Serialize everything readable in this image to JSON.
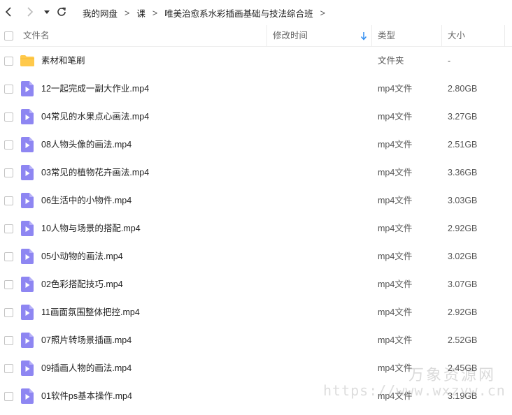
{
  "breadcrumb": [
    "我的网盘",
    "课",
    "唯美治愈系水彩插画基础与技法综合班"
  ],
  "breadcrumb_separator": ">",
  "columns": {
    "name": "文件名",
    "modified": "修改时间",
    "type": "类型",
    "size": "大小"
  },
  "sort": {
    "column": "modified",
    "direction": "descending"
  },
  "colors": {
    "folder": "#FFC94B",
    "video": "#8E86F2",
    "sort_arrow": "#2F8CF0"
  },
  "files": [
    {
      "name": "素材和笔刷",
      "type": "文件夹",
      "size": "-",
      "icon": "folder-icon"
    },
    {
      "name": "12一起完成一副大作业.mp4",
      "type": "mp4文件",
      "size": "2.80GB",
      "icon": "video-file-icon"
    },
    {
      "name": "04常见的水果点心画法.mp4",
      "type": "mp4文件",
      "size": "3.27GB",
      "icon": "video-file-icon"
    },
    {
      "name": "08人物头像的画法.mp4",
      "type": "mp4文件",
      "size": "2.51GB",
      "icon": "video-file-icon"
    },
    {
      "name": "03常见的植物花卉画法.mp4",
      "type": "mp4文件",
      "size": "3.36GB",
      "icon": "video-file-icon"
    },
    {
      "name": "06生活中的小物件.mp4",
      "type": "mp4文件",
      "size": "3.03GB",
      "icon": "video-file-icon"
    },
    {
      "name": "10人物与场景的搭配.mp4",
      "type": "mp4文件",
      "size": "2.92GB",
      "icon": "video-file-icon"
    },
    {
      "name": "05小动物的画法.mp4",
      "type": "mp4文件",
      "size": "3.02GB",
      "icon": "video-file-icon"
    },
    {
      "name": "02色彩搭配技巧.mp4",
      "type": "mp4文件",
      "size": "3.07GB",
      "icon": "video-file-icon"
    },
    {
      "name": "11画面氛围整体把控.mp4",
      "type": "mp4文件",
      "size": "2.92GB",
      "icon": "video-file-icon"
    },
    {
      "name": "07照片转场景插画.mp4",
      "type": "mp4文件",
      "size": "2.52GB",
      "icon": "video-file-icon"
    },
    {
      "name": "09插画人物的画法.mp4",
      "type": "mp4文件",
      "size": "2.45GB",
      "icon": "video-file-icon"
    },
    {
      "name": "01软件ps基本操作.mp4",
      "type": "mp4文件",
      "size": "3.19GB",
      "icon": "video-file-icon"
    }
  ],
  "watermark": {
    "line1": "万象资源网",
    "line2": "https://www.wxzyw.cn"
  }
}
